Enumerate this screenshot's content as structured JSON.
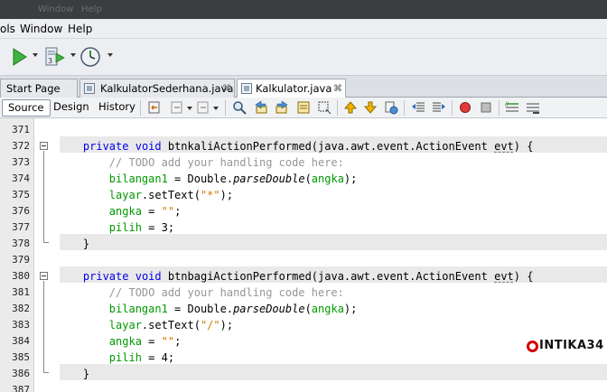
{
  "titlebar": {
    "items": [
      "Window",
      "Help"
    ]
  },
  "menu": {
    "items": [
      "ols",
      "Window",
      "Help"
    ]
  },
  "toolbar": {
    "icons": [
      "run-icon",
      "build-project-icon",
      "profile-icon"
    ]
  },
  "tabs": [
    {
      "label": "Start Page",
      "active": false
    },
    {
      "label": "KalkulatorSederhana.java",
      "active": false
    },
    {
      "label": "Kalkulator.java",
      "active": true
    }
  ],
  "close_glyph": "⌘",
  "editor_tabs": {
    "source": "Source",
    "design": "Design",
    "history": "History"
  },
  "code": {
    "line_numbers": [
      "371",
      "372",
      "373",
      "374",
      "375",
      "376",
      "377",
      "378",
      "379",
      "380",
      "381",
      "382",
      "383",
      "384",
      "385",
      "386",
      "387"
    ],
    "m1_private": "private",
    "m1_void": "void",
    "m1_rest": " btnkaliActionPerformed(java.awt.event.ActionEvent ",
    "m1_evt": "evt",
    "m1_end": ") {",
    "m1_todo": "// TODO add your handling code here:",
    "m1_b1": "bilangan1",
    "m1_b1_mid": " = Double.",
    "m1_b1_parse": "parseDouble",
    "m1_b1_open": "(",
    "m1_b1_arg": "angka",
    "m1_b1_end": ");",
    "m1_layar": "layar",
    "m1_layar_mid": ".setText(",
    "m1_layar_str": "\"*\"",
    "m1_layar_end": ");",
    "m1_angka": "angka",
    "m1_angka_mid": " = ",
    "m1_angka_str": "\"\"",
    "m1_angka_end": ";",
    "m1_pilih": "pilih",
    "m1_pilih_rest": " = 3;",
    "m1_close": "}",
    "m2_private": "private",
    "m2_void": "void",
    "m2_rest": " btnbagiActionPerformed(java.awt.event.ActionEvent ",
    "m2_evt": "evt",
    "m2_end": ") {",
    "m2_todo": "// TODO add your handling code here:",
    "m2_b1": "bilangan1",
    "m2_b1_mid": " = Double.",
    "m2_b1_parse": "parseDouble",
    "m2_b1_open": "(",
    "m2_b1_arg": "angka",
    "m2_b1_end": ");",
    "m2_layar": "layar",
    "m2_layar_mid": ".setText(",
    "m2_layar_str": "\"/\"",
    "m2_layar_end": ");",
    "m2_angka": "angka",
    "m2_angka_mid": " = ",
    "m2_angka_str": "\"\"",
    "m2_angka_end": ";",
    "m2_pilih": "pilih",
    "m2_pilih_rest": " = 4;",
    "m2_close": "}"
  },
  "watermark": {
    "text": "INTIKA34"
  },
  "colors": {
    "keyword": "#0000e6",
    "comment": "#969696",
    "field": "#009900",
    "string": "#ce7b00",
    "watermark_red": "#d10000"
  }
}
